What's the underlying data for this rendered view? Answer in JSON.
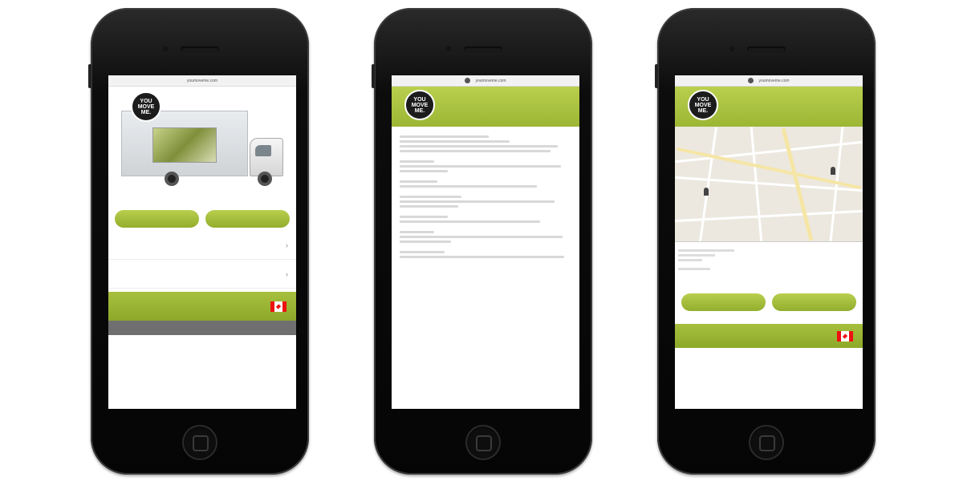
{
  "brand": {
    "logo_lines": [
      "YOU",
      "MOVE",
      "ME."
    ],
    "green": "#a7bf3d",
    "dark": "#1c1c1c"
  },
  "phone1": {
    "url_text": "youmoveme.com",
    "buttons": [
      "",
      ""
    ],
    "nav": [
      {
        "label": "",
        "icon": "chevron-right-icon"
      },
      {
        "label": "",
        "icon": "chevron-right-icon"
      }
    ],
    "footer_label": "",
    "subfooter": ""
  },
  "phone2": {
    "url_text": "youmoveme.com",
    "header_title": ""
  },
  "phone3": {
    "url_text": "youmoveme.com",
    "header_title": "",
    "center_link": "",
    "buttons": [
      "",
      ""
    ],
    "footer_label": ""
  }
}
